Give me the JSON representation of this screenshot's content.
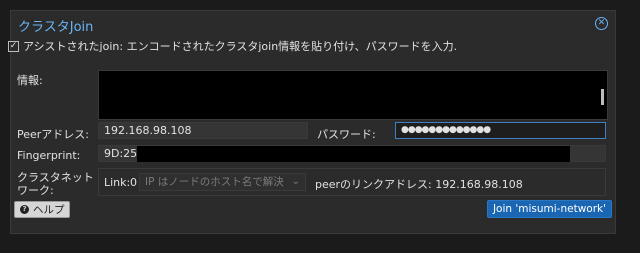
{
  "dialog": {
    "title": "クラスタJoin",
    "close_icon": "⊗"
  },
  "assist": {
    "checked": true,
    "label": "アシストされたjoin: エンコードされたクラスタjoin情報を貼り付け、パスワードを入力."
  },
  "info": {
    "label": "情報:",
    "value": ""
  },
  "peer": {
    "label": "Peerアドレス:",
    "value": "192.168.98.108"
  },
  "password": {
    "label": "パスワード:",
    "value": "●●●●●●●●●●●●●"
  },
  "fingerprint": {
    "label": "Fingerprint:",
    "value": "9D:25:7"
  },
  "cluster_network": {
    "label_line1": "クラスタネット",
    "label_line2": "ワーク:",
    "link_label": "Link:",
    "link_number": "0",
    "select_placeholder": "IP はノードのホスト名で解決",
    "peer_link_text": "peerのリンクアドレス: 192.168.98.108"
  },
  "footer": {
    "help_label": "ヘルプ",
    "join_label": "Join 'misumi-network'"
  },
  "colors": {
    "accent": "#6ab4f5",
    "primary_button": "#1a66b3",
    "background": "#2b2b2b"
  }
}
